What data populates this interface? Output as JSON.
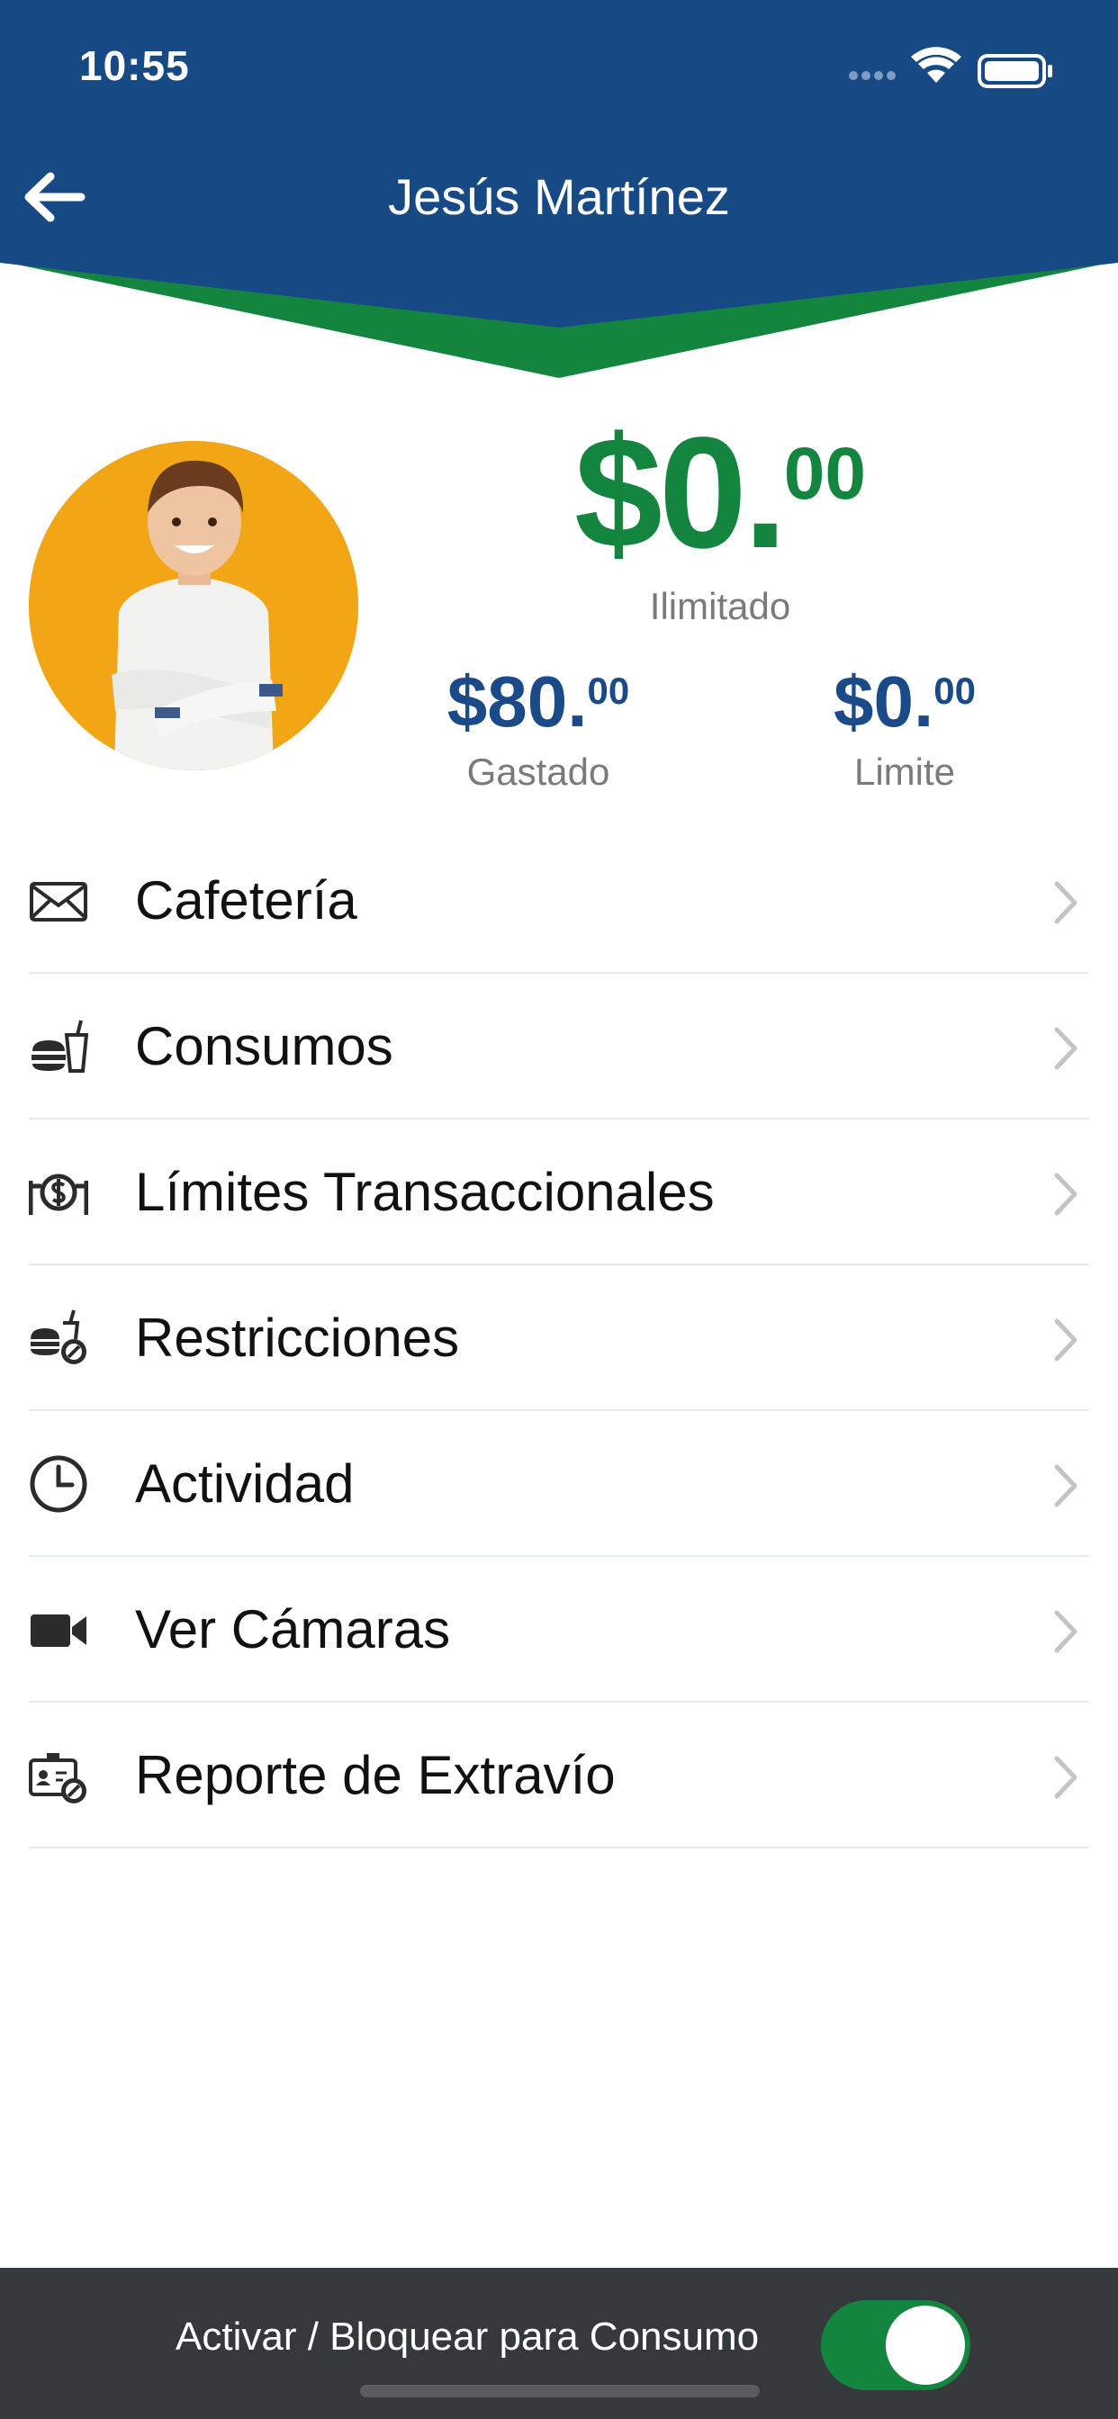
{
  "status_bar": {
    "time": "10:55"
  },
  "header": {
    "title": "Jesús Martínez",
    "colors": {
      "primary": "#174a85",
      "accent": "#13853f"
    }
  },
  "balance": {
    "main_integer": "$0.",
    "main_decimal": "00",
    "main_label": "Ilimitado",
    "spent_integer": "$80.",
    "spent_decimal": "00",
    "spent_label": "Gastado",
    "limit_integer": "$0.",
    "limit_decimal": "00",
    "limit_label": "Limite"
  },
  "menu": {
    "items": [
      {
        "label": "Cafetería",
        "icon": "envelope-icon"
      },
      {
        "label": "Consumos",
        "icon": "burger-drink-icon"
      },
      {
        "label": "Límites Transaccionales",
        "icon": "money-limit-icon"
      },
      {
        "label": "Restricciones",
        "icon": "food-restricted-icon"
      },
      {
        "label": "Actividad",
        "icon": "clock-icon"
      },
      {
        "label": "Ver Cámaras",
        "icon": "video-camera-icon"
      },
      {
        "label": "Reporte de Extravío",
        "icon": "id-card-blocked-icon"
      }
    ]
  },
  "bottom": {
    "toggle_label": "Activar / Bloquear para Consumo",
    "toggle_on": true
  }
}
